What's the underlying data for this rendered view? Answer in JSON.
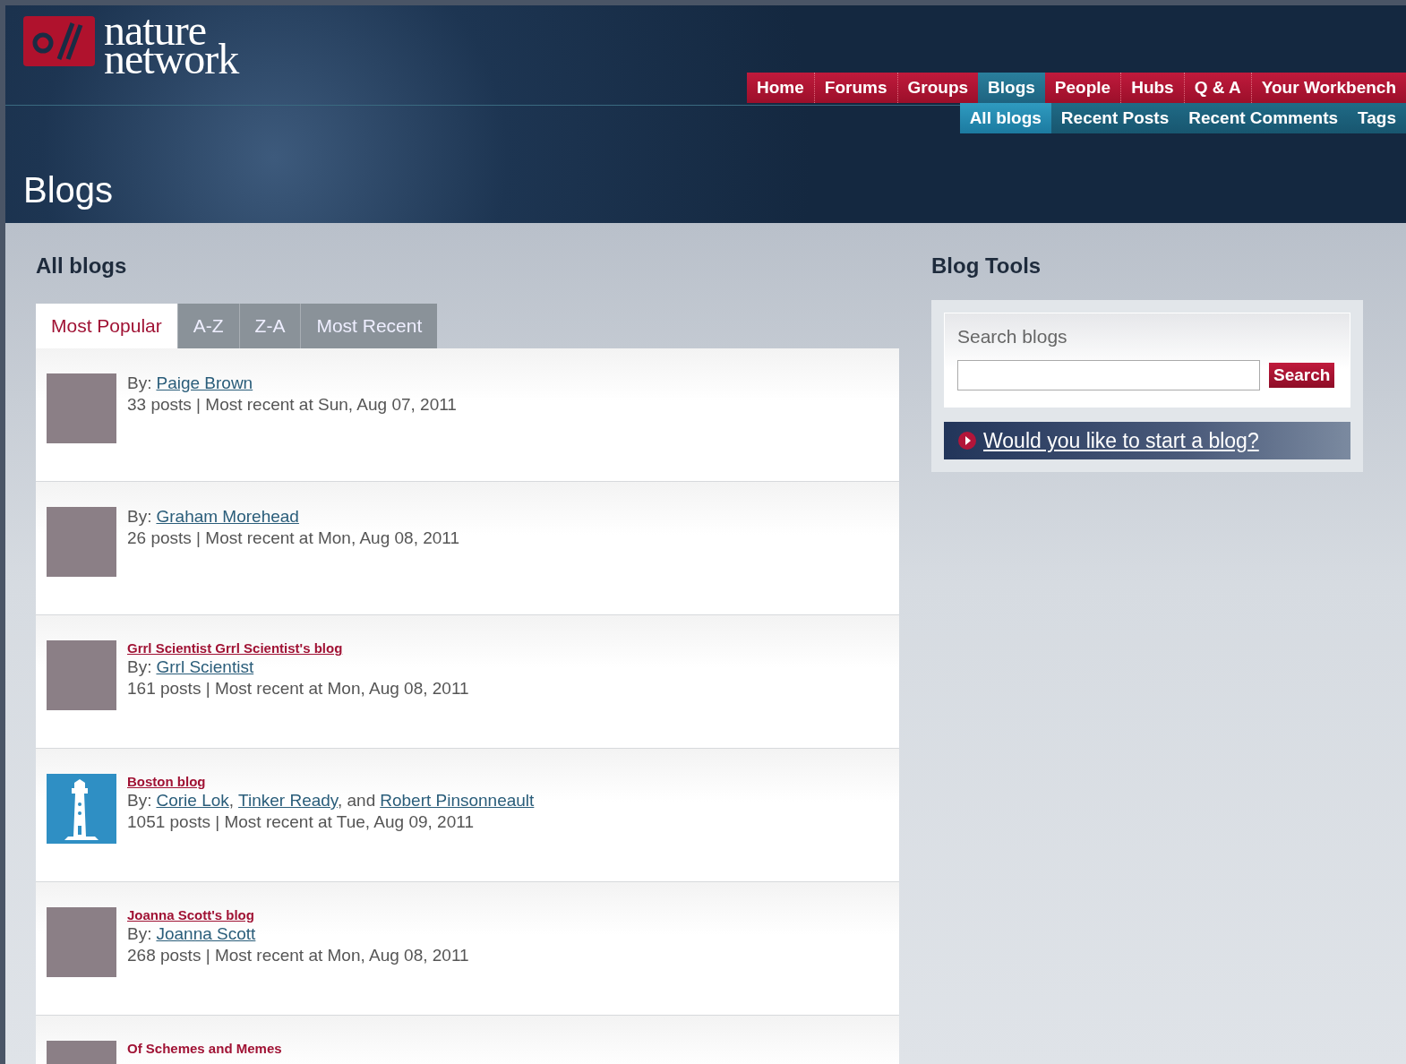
{
  "logo": {
    "line_1": "nature",
    "line_2": "network"
  },
  "main_nav": [
    {
      "label": "Home",
      "selected": false
    },
    {
      "label": "Forums",
      "selected": false
    },
    {
      "label": "Groups",
      "selected": false
    },
    {
      "label": "Blogs",
      "selected": true
    },
    {
      "label": "People",
      "selected": false
    },
    {
      "label": "Hubs",
      "selected": false
    },
    {
      "label": "Q & A",
      "selected": false
    },
    {
      "label": "Your Workbench",
      "selected": false
    }
  ],
  "sub_nav": [
    {
      "label": "All blogs",
      "selected": true
    },
    {
      "label": "Recent Posts",
      "selected": false
    },
    {
      "label": "Recent Comments",
      "selected": false
    },
    {
      "label": "Tags",
      "selected": false
    }
  ],
  "page_title": "Blogs",
  "section_title": "All blogs",
  "tabs": [
    {
      "label": "Most Popular",
      "selected": true
    },
    {
      "label": "A-Z",
      "selected": false
    },
    {
      "label": "Z-A",
      "selected": false
    },
    {
      "label": "Most Recent",
      "selected": false
    }
  ],
  "blogs": [
    {
      "kind": "photo",
      "by": [
        {
          "kind": "plain",
          "text": "By:"
        },
        {
          "kind": "link",
          "text": "Paige Brown"
        }
      ],
      "stats": "33 posts | Most recent at Sun, Aug 07, 2011"
    },
    {
      "kind": "photo",
      "by": [
        {
          "kind": "plain",
          "text": "By:"
        },
        {
          "kind": "link",
          "text": "Graham Morehead"
        }
      ],
      "stats": "26 posts | Most recent at Mon, Aug 08, 2011"
    },
    {
      "kind": "photo",
      "title": "Grrl Scientist Grrl Scientist's blog",
      "by": [
        {
          "kind": "plain",
          "text": "By:"
        },
        {
          "kind": "link",
          "text": "Grrl Scientist"
        }
      ],
      "stats": "161 posts | Most recent at Mon, Aug 08, 2011"
    },
    {
      "kind": "lighthouse",
      "title": "Boston blog",
      "by": [
        {
          "kind": "plain",
          "text": "By:"
        },
        {
          "kind": "link",
          "text": "Corie Lok"
        },
        {
          "kind": "plain",
          "text": ","
        },
        {
          "kind": "link",
          "text": "Tinker Ready"
        },
        {
          "kind": "plain",
          "text": ", and"
        },
        {
          "kind": "link",
          "text": "Robert Pinsonneault"
        }
      ],
      "stats": "1051 posts | Most recent at Tue, Aug 09, 2011"
    },
    {
      "kind": "photo",
      "title": "Joanna Scott's blog",
      "by": [
        {
          "kind": "plain",
          "text": "By:"
        },
        {
          "kind": "link",
          "text": "Joanna Scott"
        }
      ],
      "stats": "268 posts | Most recent at Mon, Aug 08, 2011"
    },
    {
      "kind": "photo",
      "title": "Of Schemes and Memes",
      "title_underlined": false
    }
  ],
  "tools": {
    "title": "Blog Tools",
    "search_label": "Search blogs",
    "search_button": "Search",
    "cta": "Would you like to start a blog?"
  }
}
